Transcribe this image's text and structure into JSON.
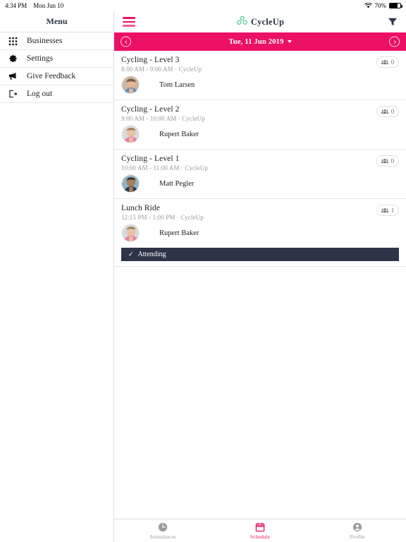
{
  "statusbar": {
    "time": "4:34 PM",
    "date": "Mon Jun 10",
    "battery_percent": "70%",
    "wifi_icon": "wifi-icon",
    "battery_icon": "battery-icon"
  },
  "sidebar": {
    "title": "Menu",
    "items": [
      {
        "label": "Businesses",
        "icon": "grid-icon"
      },
      {
        "label": "Settings",
        "icon": "gear-icon"
      },
      {
        "label": "Give Feedback",
        "icon": "megaphone-icon"
      },
      {
        "label": "Log out",
        "icon": "logout-icon"
      }
    ]
  },
  "appbar": {
    "menu_icon": "hamburger-icon",
    "brand": "CycleUp",
    "logo_icon": "cycleup-logo-icon",
    "filter_icon": "filter-icon"
  },
  "datebar": {
    "date": "Tue, 11 Jun 2019",
    "prev_icon": "chevron-left-icon",
    "next_icon": "chevron-right-icon",
    "dropdown_icon": "caret-down-icon"
  },
  "schedule": {
    "classes": [
      {
        "title": "Cycling - Level 3",
        "subtitle": "8:00 AM - 9:00 AM · CycleUp",
        "instructor": "Tom Larsen",
        "count": "0",
        "count_icon": "people-icon",
        "attending": false
      },
      {
        "title": "Cycling - Level 2",
        "subtitle": "9:00 AM - 10:00 AM · CycleUp",
        "instructor": "Rupert Baker",
        "count": "0",
        "count_icon": "people-icon",
        "attending": false
      },
      {
        "title": "Cycling - Level 1",
        "subtitle": "10:00 AM - 11:00 AM · CycleUp",
        "instructor": "Matt Pegler",
        "count": "0",
        "count_icon": "people-icon",
        "attending": false
      },
      {
        "title": "Lunch Ride",
        "subtitle": "12:15 PM - 1:00 PM · CycleUp",
        "instructor": "Rupert Baker",
        "count": "1",
        "count_icon": "people-icon",
        "attending": true,
        "attending_label": "Attending",
        "attending_check": "✓"
      }
    ]
  },
  "tabbar": {
    "tabs": [
      {
        "label": "Attendances",
        "icon": "clock-icon",
        "active": false
      },
      {
        "label": "Schedule",
        "icon": "calendar-icon",
        "active": true
      },
      {
        "label": "Profile",
        "icon": "person-icon",
        "active": false
      }
    ]
  },
  "colors": {
    "accent_pink": "#ec1164",
    "brand_green": "#4ecb9a",
    "dark_navy": "#2e3549",
    "muted_gray": "#9a9a9a"
  }
}
